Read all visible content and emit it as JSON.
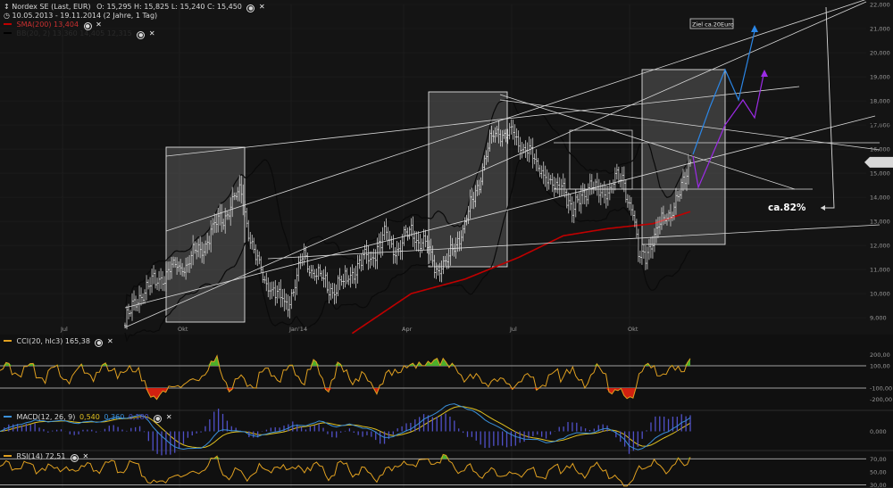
{
  "header": {
    "title": "Nordex SE (Last, EUR)",
    "ohlc": "O: 15,295  H: 15,825  L: 15,240  C: 15,450",
    "period": "10.05.2013 - 19.11.2014 (2 Jahre, 1 Tag)",
    "sma_label": "SMA(200) 13,404",
    "bb_label": "BB(20, 2) 13,360  14,405  12,315"
  },
  "annotations": {
    "target": "Ziel ca.20Euro",
    "percent": "ca.82%"
  },
  "indicators": {
    "cci": "CCI(20, hlc3) 165,38",
    "macd_prefix": "MACD(12, 26, 9)",
    "macd_v1": "0,540",
    "macd_v2": "0,360",
    "macd_v3": "0,180",
    "rsi": "RSI(14) 72,51"
  },
  "colors": {
    "background": "#141414",
    "price_bars": "#e8e8e8",
    "bollinger": "#0a0a0a",
    "sma": "#c00000",
    "cci_line": "#e0a020",
    "positive_fill": "#4caf2a",
    "negative_fill": "#d02010",
    "macd_line": "#3a8fd8",
    "signal_line": "#e0c020",
    "histogram": "#5050c8",
    "arrow_blue": "#2b86e6",
    "arrow_purple": "#9c2be6"
  },
  "chart_data": [
    {
      "type": "line",
      "name": "price",
      "ylim": [
        8.3,
        22.0
      ],
      "yticks": [
        "9,000",
        "10,000",
        "11,000",
        "12,000",
        "13,000",
        "14,000",
        "15,000",
        "16,000",
        "17,000",
        "18,000",
        "19,000",
        "20,000",
        "21,000",
        "22,000"
      ],
      "xticks": [
        "Jul",
        "Okt",
        "Jan'14",
        "Apr",
        "Jul",
        "Okt"
      ],
      "last_price_label": "15,450",
      "close_anchors": [
        [
          0,
          8.8
        ],
        [
          8,
          9.9
        ],
        [
          15,
          10.4
        ],
        [
          25,
          10.9
        ],
        [
          35,
          11.3
        ],
        [
          45,
          12.1
        ],
        [
          50,
          12.8
        ],
        [
          55,
          13.2
        ],
        [
          60,
          13.8
        ],
        [
          65,
          14.2
        ],
        [
          68,
          13.0
        ],
        [
          72,
          11.6
        ],
        [
          78,
          10.6
        ],
        [
          84,
          10.0
        ],
        [
          90,
          9.6
        ],
        [
          95,
          10.3
        ],
        [
          100,
          11.6
        ],
        [
          108,
          10.7
        ],
        [
          115,
          10.2
        ],
        [
          122,
          10.4
        ],
        [
          130,
          11.2
        ],
        [
          138,
          11.6
        ],
        [
          145,
          12.3
        ],
        [
          152,
          11.8
        ],
        [
          160,
          12.6
        ],
        [
          168,
          11.9
        ],
        [
          175,
          11.0
        ],
        [
          180,
          11.3
        ],
        [
          185,
          12.1
        ],
        [
          190,
          12.9
        ],
        [
          195,
          14.0
        ],
        [
          200,
          15.2
        ],
        [
          205,
          16.4
        ],
        [
          210,
          16.8
        ],
        [
          215,
          16.7
        ],
        [
          220,
          16.3
        ],
        [
          225,
          16.0
        ],
        [
          230,
          15.3
        ],
        [
          235,
          15.0
        ],
        [
          240,
          14.3
        ],
        [
          245,
          14.6
        ],
        [
          250,
          13.4
        ],
        [
          255,
          14.0
        ],
        [
          260,
          14.5
        ],
        [
          265,
          14.1
        ],
        [
          270,
          14.3
        ],
        [
          275,
          14.7
        ],
        [
          279,
          14.5
        ],
        [
          284,
          13.4
        ],
        [
          287,
          11.4
        ],
        [
          291,
          11.6
        ],
        [
          296,
          12.4
        ],
        [
          301,
          13.0
        ],
        [
          306,
          13.6
        ],
        [
          311,
          14.2
        ],
        [
          316,
          15.45
        ]
      ],
      "sma200_anchors": [
        [
          80,
          6.0
        ],
        [
          140,
          9.0
        ],
        [
          160,
          10.0
        ],
        [
          190,
          10.6
        ],
        [
          220,
          11.5
        ],
        [
          245,
          12.4
        ],
        [
          270,
          12.7
        ],
        [
          295,
          12.9
        ],
        [
          316,
          13.4
        ]
      ]
    },
    {
      "type": "area",
      "name": "CCI(20, hlc3)",
      "ylim": [
        -300,
        300
      ],
      "yticks": [
        "200,00",
        "100,00",
        "-100,00",
        "-200,00"
      ],
      "levels": [
        100,
        -100
      ],
      "last": 165.38
    },
    {
      "type": "line",
      "name": "MACD(12, 26, 9)",
      "ylim": [
        -0.8,
        0.8
      ],
      "yticks": [
        "0,000"
      ],
      "last": [
        0.54,
        0.36,
        0.18
      ]
    },
    {
      "type": "area",
      "name": "RSI(14)",
      "ylim": [
        25,
        80
      ],
      "yticks": [
        "70,00",
        "50,00",
        "30,00"
      ],
      "levels": [
        70,
        30
      ],
      "last": 72.51
    }
  ]
}
